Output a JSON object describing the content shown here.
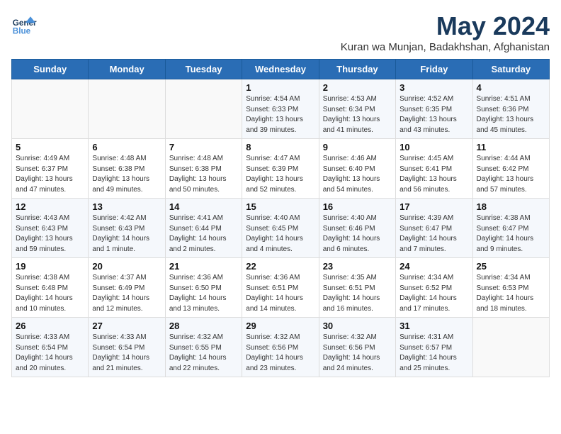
{
  "header": {
    "logo_line1": "General",
    "logo_line2": "Blue",
    "title": "May 2024",
    "subtitle": "Kuran wa Munjan, Badakhshan, Afghanistan"
  },
  "weekdays": [
    "Sunday",
    "Monday",
    "Tuesday",
    "Wednesday",
    "Thursday",
    "Friday",
    "Saturday"
  ],
  "weeks": [
    [
      {
        "day": "",
        "info": ""
      },
      {
        "day": "",
        "info": ""
      },
      {
        "day": "",
        "info": ""
      },
      {
        "day": "1",
        "info": "Sunrise: 4:54 AM\nSunset: 6:33 PM\nDaylight: 13 hours\nand 39 minutes."
      },
      {
        "day": "2",
        "info": "Sunrise: 4:53 AM\nSunset: 6:34 PM\nDaylight: 13 hours\nand 41 minutes."
      },
      {
        "day": "3",
        "info": "Sunrise: 4:52 AM\nSunset: 6:35 PM\nDaylight: 13 hours\nand 43 minutes."
      },
      {
        "day": "4",
        "info": "Sunrise: 4:51 AM\nSunset: 6:36 PM\nDaylight: 13 hours\nand 45 minutes."
      }
    ],
    [
      {
        "day": "5",
        "info": "Sunrise: 4:49 AM\nSunset: 6:37 PM\nDaylight: 13 hours\nand 47 minutes."
      },
      {
        "day": "6",
        "info": "Sunrise: 4:48 AM\nSunset: 6:38 PM\nDaylight: 13 hours\nand 49 minutes."
      },
      {
        "day": "7",
        "info": "Sunrise: 4:48 AM\nSunset: 6:38 PM\nDaylight: 13 hours\nand 50 minutes."
      },
      {
        "day": "8",
        "info": "Sunrise: 4:47 AM\nSunset: 6:39 PM\nDaylight: 13 hours\nand 52 minutes."
      },
      {
        "day": "9",
        "info": "Sunrise: 4:46 AM\nSunset: 6:40 PM\nDaylight: 13 hours\nand 54 minutes."
      },
      {
        "day": "10",
        "info": "Sunrise: 4:45 AM\nSunset: 6:41 PM\nDaylight: 13 hours\nand 56 minutes."
      },
      {
        "day": "11",
        "info": "Sunrise: 4:44 AM\nSunset: 6:42 PM\nDaylight: 13 hours\nand 57 minutes."
      }
    ],
    [
      {
        "day": "12",
        "info": "Sunrise: 4:43 AM\nSunset: 6:43 PM\nDaylight: 13 hours\nand 59 minutes."
      },
      {
        "day": "13",
        "info": "Sunrise: 4:42 AM\nSunset: 6:43 PM\nDaylight: 14 hours\nand 1 minute."
      },
      {
        "day": "14",
        "info": "Sunrise: 4:41 AM\nSunset: 6:44 PM\nDaylight: 14 hours\nand 2 minutes."
      },
      {
        "day": "15",
        "info": "Sunrise: 4:40 AM\nSunset: 6:45 PM\nDaylight: 14 hours\nand 4 minutes."
      },
      {
        "day": "16",
        "info": "Sunrise: 4:40 AM\nSunset: 6:46 PM\nDaylight: 14 hours\nand 6 minutes."
      },
      {
        "day": "17",
        "info": "Sunrise: 4:39 AM\nSunset: 6:47 PM\nDaylight: 14 hours\nand 7 minutes."
      },
      {
        "day": "18",
        "info": "Sunrise: 4:38 AM\nSunset: 6:47 PM\nDaylight: 14 hours\nand 9 minutes."
      }
    ],
    [
      {
        "day": "19",
        "info": "Sunrise: 4:38 AM\nSunset: 6:48 PM\nDaylight: 14 hours\nand 10 minutes."
      },
      {
        "day": "20",
        "info": "Sunrise: 4:37 AM\nSunset: 6:49 PM\nDaylight: 14 hours\nand 12 minutes."
      },
      {
        "day": "21",
        "info": "Sunrise: 4:36 AM\nSunset: 6:50 PM\nDaylight: 14 hours\nand 13 minutes."
      },
      {
        "day": "22",
        "info": "Sunrise: 4:36 AM\nSunset: 6:51 PM\nDaylight: 14 hours\nand 14 minutes."
      },
      {
        "day": "23",
        "info": "Sunrise: 4:35 AM\nSunset: 6:51 PM\nDaylight: 14 hours\nand 16 minutes."
      },
      {
        "day": "24",
        "info": "Sunrise: 4:34 AM\nSunset: 6:52 PM\nDaylight: 14 hours\nand 17 minutes."
      },
      {
        "day": "25",
        "info": "Sunrise: 4:34 AM\nSunset: 6:53 PM\nDaylight: 14 hours\nand 18 minutes."
      }
    ],
    [
      {
        "day": "26",
        "info": "Sunrise: 4:33 AM\nSunset: 6:54 PM\nDaylight: 14 hours\nand 20 minutes."
      },
      {
        "day": "27",
        "info": "Sunrise: 4:33 AM\nSunset: 6:54 PM\nDaylight: 14 hours\nand 21 minutes."
      },
      {
        "day": "28",
        "info": "Sunrise: 4:32 AM\nSunset: 6:55 PM\nDaylight: 14 hours\nand 22 minutes."
      },
      {
        "day": "29",
        "info": "Sunrise: 4:32 AM\nSunset: 6:56 PM\nDaylight: 14 hours\nand 23 minutes."
      },
      {
        "day": "30",
        "info": "Sunrise: 4:32 AM\nSunset: 6:56 PM\nDaylight: 14 hours\nand 24 minutes."
      },
      {
        "day": "31",
        "info": "Sunrise: 4:31 AM\nSunset: 6:57 PM\nDaylight: 14 hours\nand 25 minutes."
      },
      {
        "day": "",
        "info": ""
      }
    ]
  ]
}
